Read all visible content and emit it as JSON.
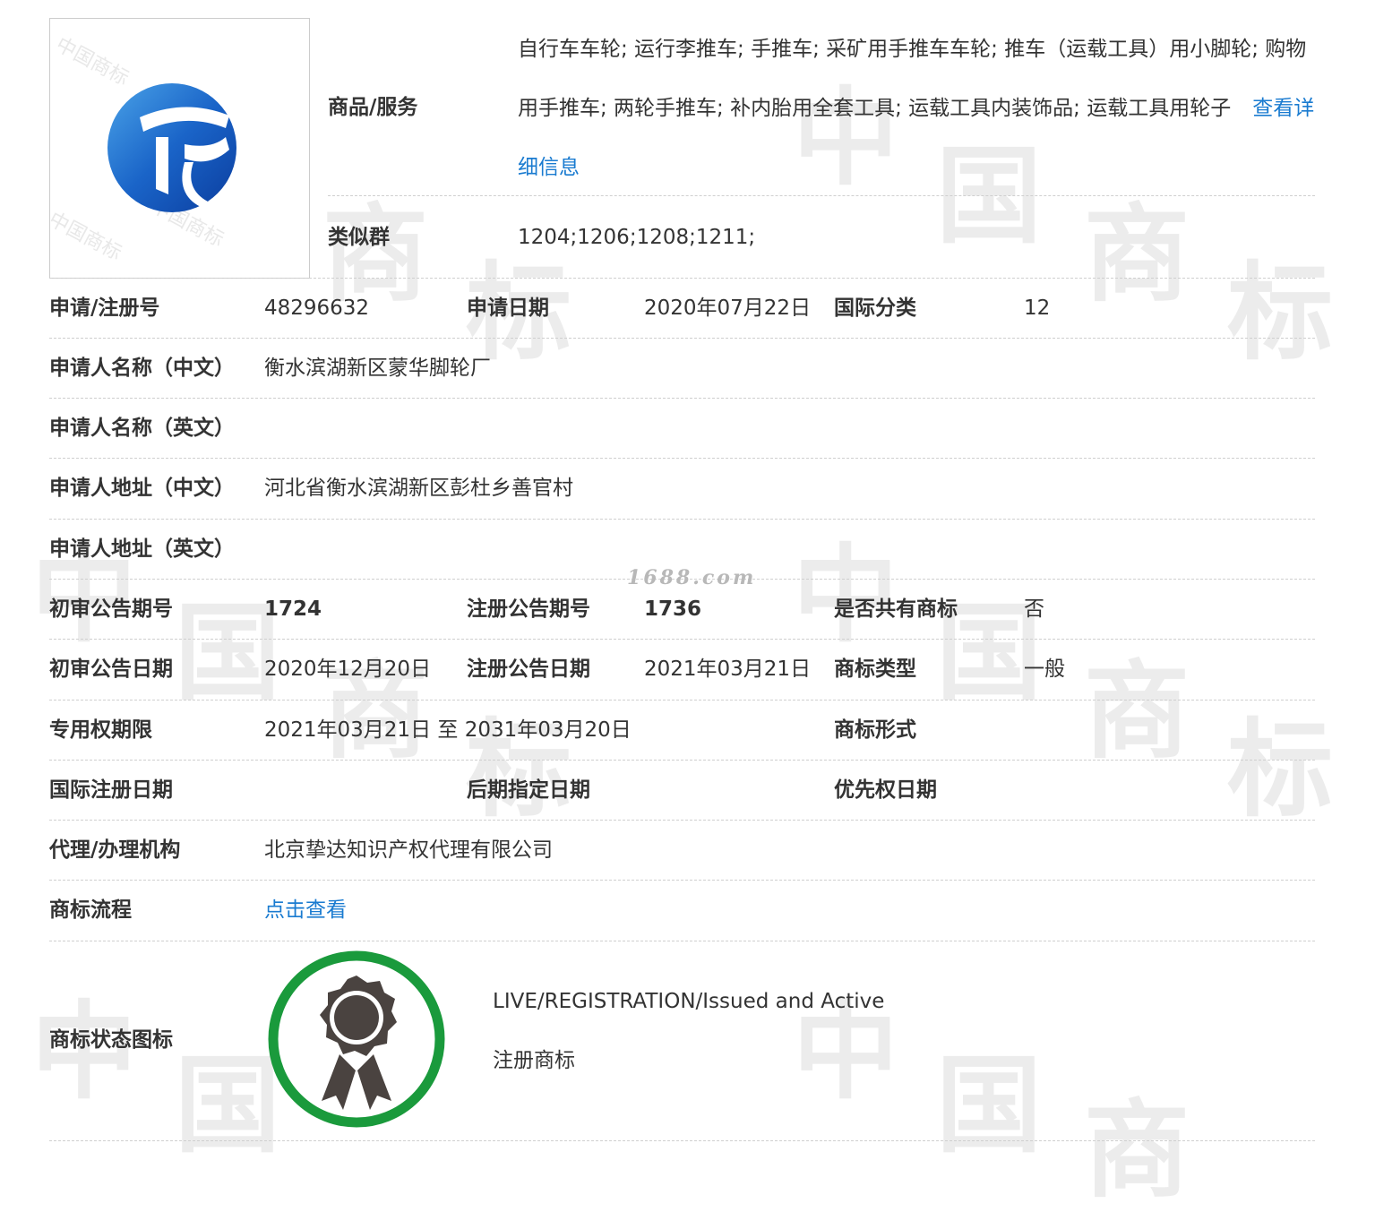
{
  "watermark_text": {
    "zhong": "中",
    "guo": "国",
    "shang": "商",
    "biao": "标"
  },
  "logo": {
    "watermark_small": "中国商标",
    "colors": [
      "#1a64c8",
      "#0b3d9e",
      "#4aa3e8"
    ]
  },
  "site_watermark": "1688.com",
  "goods": {
    "label": "商品/服务",
    "text": "自行车车轮; 运行李推车; 手推车; 采矿用手推车车轮; 推车（运载工具）用小脚轮; 购物用手推车; 两轮手推车; 补内胎用全套工具; 运载工具内装饰品; 运载工具用轮子",
    "more_link": "查看详细信息"
  },
  "similar_group": {
    "label": "类似群",
    "value": "1204;1206;1208;1211;"
  },
  "rows": {
    "app_no": {
      "label": "申请/注册号",
      "value": "48296632"
    },
    "app_date": {
      "label": "申请日期",
      "value": "2020年07月22日"
    },
    "intl_class": {
      "label": "国际分类",
      "value": "12"
    },
    "name_cn": {
      "label": "申请人名称（中文）",
      "value": "衡水滨湖新区蒙华脚轮厂"
    },
    "name_en": {
      "label": "申请人名称（英文）",
      "value": ""
    },
    "addr_cn": {
      "label": "申请人地址（中文）",
      "value": "河北省衡水滨湖新区彭杜乡善官村"
    },
    "addr_en": {
      "label": "申请人地址（英文）",
      "value": ""
    },
    "prelim_no": {
      "label": "初审公告期号",
      "value": "1724"
    },
    "reg_no": {
      "label": "注册公告期号",
      "value": "1736"
    },
    "shared": {
      "label": "是否共有商标",
      "value": "否"
    },
    "prelim_date": {
      "label": "初审公告日期",
      "value": "2020年12月20日"
    },
    "reg_date": {
      "label": "注册公告日期",
      "value": "2021年03月21日"
    },
    "tm_type": {
      "label": "商标类型",
      "value": "一般"
    },
    "exclusive": {
      "label": "专用权期限",
      "value": "2021年03月21日 至 2031年03月20日"
    },
    "tm_form": {
      "label": "商标形式",
      "value": ""
    },
    "intl_reg_date": {
      "label": "国际注册日期",
      "value": ""
    },
    "later_date": {
      "label": "后期指定日期",
      "value": ""
    },
    "priority_date": {
      "label": "优先权日期",
      "value": ""
    },
    "agency": {
      "label": "代理/办理机构",
      "value": "北京挚达知识产权代理有限公司"
    },
    "process": {
      "label": "商标流程",
      "link": "点击查看"
    }
  },
  "status": {
    "label": "商标状态图标",
    "en": "LIVE/REGISTRATION/Issued and Active",
    "cn": "注册商标",
    "ring_color": "#1a9a3c",
    "badge_color": "#4a4340"
  }
}
